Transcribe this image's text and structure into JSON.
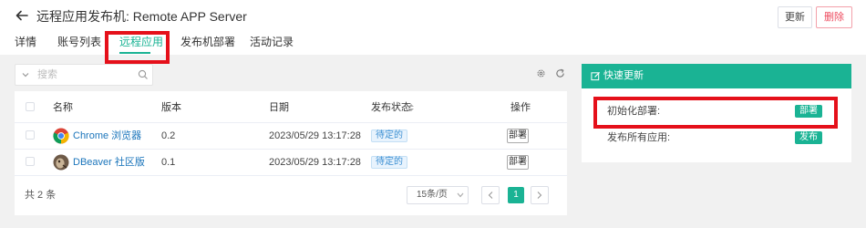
{
  "header": {
    "title": "远程应用发布机: Remote APP Server",
    "update_label": "更新",
    "delete_label": "删除"
  },
  "tabs": [
    {
      "label": "详情"
    },
    {
      "label": "账号列表"
    },
    {
      "label": "远程应用",
      "active": true
    },
    {
      "label": "发布机部署"
    },
    {
      "label": "活动记录"
    }
  ],
  "search": {
    "placeholder": "搜索",
    "value": ""
  },
  "table": {
    "columns": [
      "名称",
      "版本",
      "日期",
      "发布状态",
      "操作"
    ],
    "rows": [
      {
        "name": "Chrome 浏览器",
        "icon": "chrome-icon",
        "version": "0.2",
        "date": "2023/05/29 13:17:28",
        "status": "待定的",
        "action": "部署"
      },
      {
        "name": "DBeaver 社区版",
        "icon": "dbeaver-icon",
        "version": "0.1",
        "date": "2023/05/29 13:17:28",
        "status": "待定的",
        "action": "部署"
      }
    ],
    "total_label": "共 2 条",
    "page_size_label": "15条/页",
    "current_page": "1"
  },
  "quick_update": {
    "title": "快速更新",
    "items": [
      {
        "label": "初始化部署:",
        "button": "部署"
      },
      {
        "label": "发布所有应用:",
        "button": "发布"
      }
    ]
  },
  "colors": {
    "accent": "#1ab394",
    "link": "#1b75bb",
    "danger": "#ed4a5e",
    "highlight": "#e5101a"
  }
}
